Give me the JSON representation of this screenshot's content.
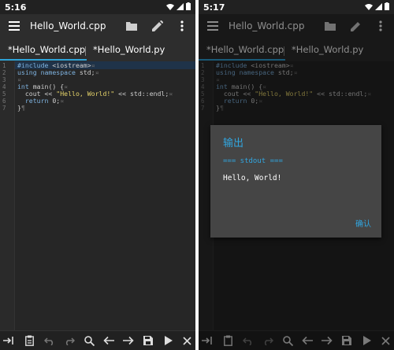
{
  "left": {
    "status": {
      "time": "5:16"
    },
    "appbar": {
      "title": "Hello_World.cpp"
    },
    "tabs": [
      {
        "label": "*Hello_World.cpp"
      },
      {
        "label": "*Hello_World.py"
      }
    ],
    "code": {
      "line_numbers": [
        "1",
        "2",
        "3",
        "4",
        "5",
        "6",
        "7"
      ],
      "lines": [
        {
          "kw": "#include",
          "rest": " <iostream>",
          "ws": "¤"
        },
        {
          "kw": "using namespace",
          "rest": " std;",
          "ws": "¤"
        },
        {
          "kw": "",
          "rest": "",
          "ws": "¤"
        },
        {
          "kw": "int",
          "rest": " main() {",
          "ws": "¤"
        },
        {
          "kw": "",
          "rest": "  cout << ",
          "str": "\"Hello, World!\"",
          "rest2": " << std::endl;",
          "ws": "¤"
        },
        {
          "kw": "  return",
          "rest": " 0;",
          "ws": "¤"
        },
        {
          "kw": "",
          "rest": "}",
          "ws": "¶"
        }
      ]
    }
  },
  "right": {
    "status": {
      "time": "5:17"
    },
    "appbar": {
      "title": "Hello_World.cpp"
    },
    "tabs": [
      {
        "label": "*Hello_World.cpp"
      },
      {
        "label": "*Hello_World.py"
      }
    ],
    "dialog": {
      "title": "输出",
      "stdout_label": "=== stdout ===",
      "output": "Hello, World!",
      "confirm": "确认"
    }
  },
  "colors": {
    "accent": "#2ea3d7",
    "background": "#212121",
    "dialog": "#454545"
  },
  "toolbar_icons": [
    "tab-icon",
    "clipboard-icon",
    "undo-icon",
    "redo-icon",
    "search-icon",
    "arrow-left-icon",
    "arrow-right-icon",
    "save-icon",
    "run-icon",
    "close-icon"
  ]
}
